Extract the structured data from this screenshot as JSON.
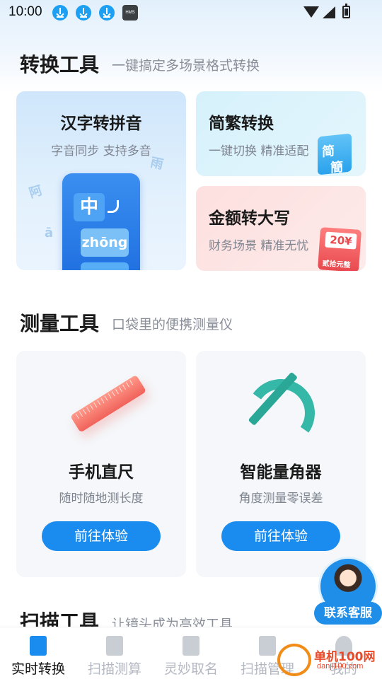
{
  "status_bar": {
    "time": "10:00",
    "hms_label": "HMS"
  },
  "sections": {
    "convert": {
      "title": "转换工具",
      "subtitle": "一键搞定多场景格式转换"
    },
    "measure": {
      "title": "测量工具",
      "subtitle": "口袋里的便携测量仪"
    },
    "scan": {
      "title": "扫描工具",
      "subtitle": "让镜头成为高效工具"
    }
  },
  "convert_cards": {
    "hanzi": {
      "title": "汉字转拼音",
      "subtitle": "字音同步 支持多音",
      "char": "中",
      "pinyin": "zhōng",
      "floats": [
        "阿",
        "雨",
        "ā"
      ]
    },
    "jianfan": {
      "title": "简繁转换",
      "subtitle": "一键切换 精准适配",
      "t1": "简",
      "t2": "簡"
    },
    "jine": {
      "title": "金额转大写",
      "subtitle": "财务场景 精准无忧",
      "amount": "20¥",
      "cn": "贰拾元整"
    }
  },
  "measure_cards": {
    "ruler": {
      "title": "手机直尺",
      "subtitle": "随时随地测长度",
      "button": "前往体验"
    },
    "protractor": {
      "title": "智能量角器",
      "subtitle": "角度测量零误差",
      "button": "前往体验"
    }
  },
  "service": {
    "label": "联系客服"
  },
  "bottom_nav": [
    {
      "label": "实时转换",
      "icon": "convert-icon",
      "active": true
    },
    {
      "label": "扫描测算",
      "icon": "scan-icon",
      "active": false
    },
    {
      "label": "灵妙取名",
      "icon": "pen-icon",
      "active": false
    },
    {
      "label": "扫描管理",
      "icon": "folder-icon",
      "active": false
    },
    {
      "label": "我的",
      "icon": "user-icon",
      "active": false
    }
  ],
  "watermark": {
    "name": "单机100网",
    "url": "danji100.com"
  },
  "colors": {
    "accent": "#1a8cf0",
    "active_nav": "#1a8cf0"
  }
}
